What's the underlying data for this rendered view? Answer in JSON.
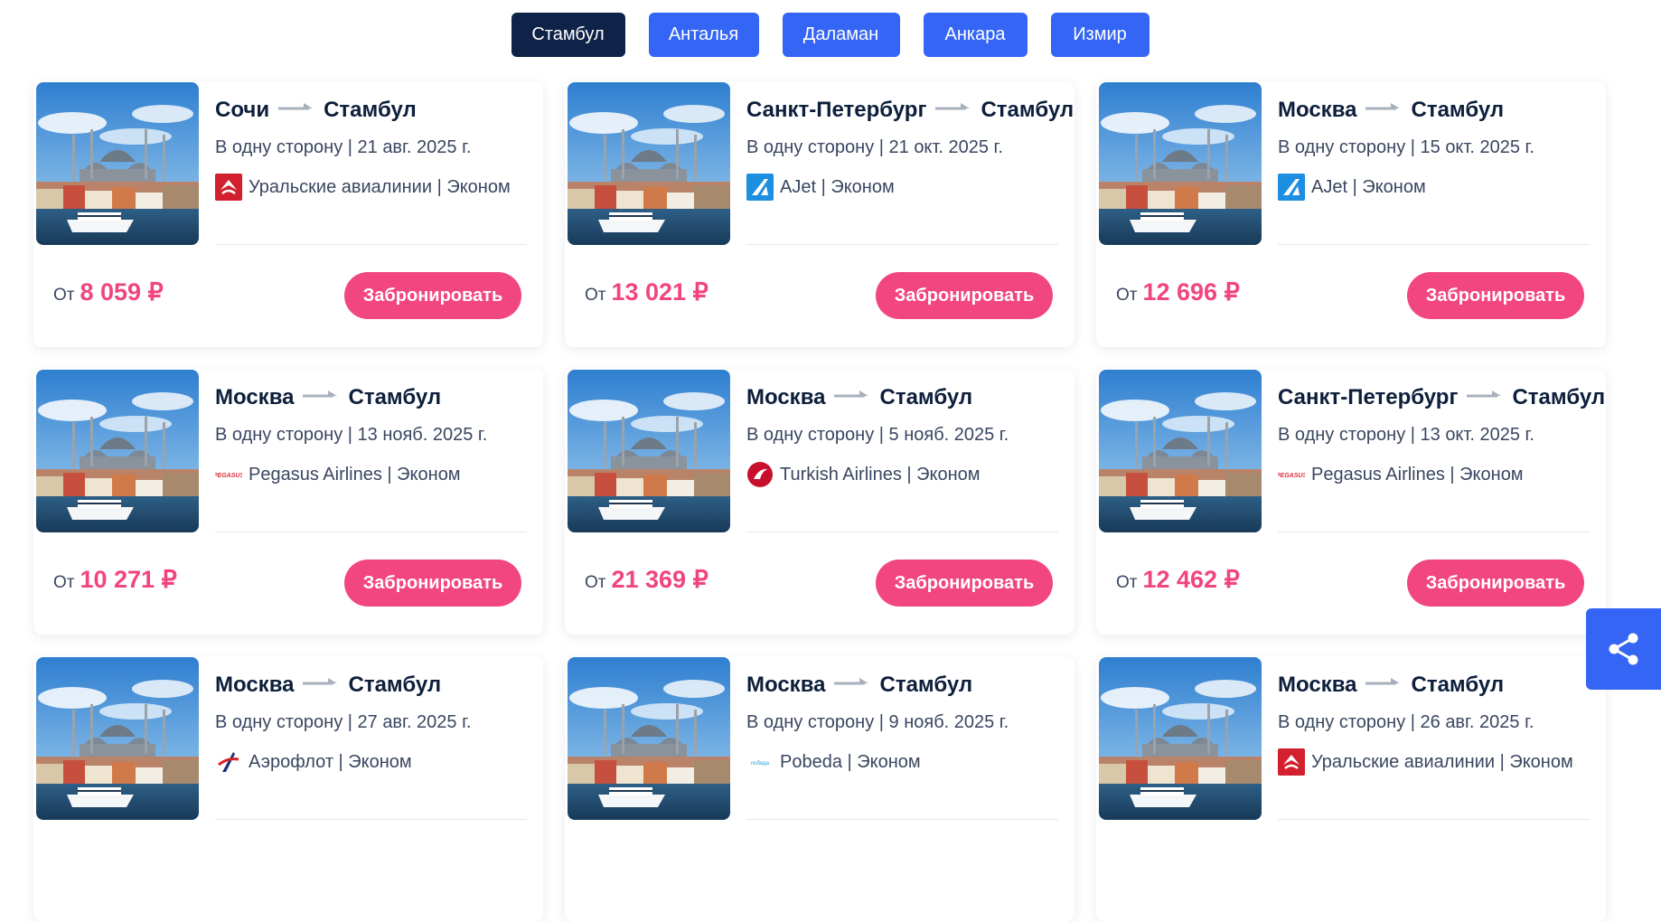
{
  "tabs": [
    "Стамбул",
    "Анталья",
    "Даламан",
    "Анкара",
    "Измир"
  ],
  "active_tab": 0,
  "price_prefix": "От",
  "book_label": "Забронировать",
  "colors": {
    "accent_blue": "#3465f4",
    "active_tab": "#0f2248",
    "pink": "#f24680",
    "navy_text": "#0d1f3c"
  },
  "cards": [
    {
      "from": "Сочи",
      "to": "Стамбул",
      "trip": "В одну сторону | 21 авг. 2025 г.",
      "airline": "Уральские авиалинии | Эконом",
      "logo": "ural-airlines-logo",
      "price": "8 059 ₽"
    },
    {
      "from": "Санкт-Петербург",
      "to": "Стамбул",
      "trip": "В одну сторону | 21 окт. 2025 г.",
      "airline": "AJet | Эконом",
      "logo": "ajet-logo",
      "price": "13 021 ₽"
    },
    {
      "from": "Москва",
      "to": "Стамбул",
      "trip": "В одну сторону | 15 окт. 2025 г.",
      "airline": "AJet | Эконом",
      "logo": "ajet-logo",
      "price": "12 696 ₽"
    },
    {
      "from": "Москва",
      "to": "Стамбул",
      "trip": "В одну сторону | 13 нояб. 2025 г.",
      "airline": "Pegasus Airlines | Эконом",
      "logo": "pegasus-logo",
      "price": "10 271 ₽"
    },
    {
      "from": "Москва",
      "to": "Стамбул",
      "trip": "В одну сторону | 5 нояб. 2025 г.",
      "airline": "Turkish Airlines | Эконом",
      "logo": "turkish-airlines-logo",
      "price": "21 369 ₽"
    },
    {
      "from": "Санкт-Петербург",
      "to": "Стамбул",
      "trip": "В одну сторону | 13 окт. 2025 г.",
      "airline": "Pegasus Airlines | Эконом",
      "logo": "pegasus-logo",
      "price": "12 462 ₽"
    },
    {
      "from": "Москва",
      "to": "Стамбул",
      "trip": "В одну сторону | 27 авг. 2025 г.",
      "airline": "Аэрофлот | Эконом",
      "logo": "aeroflot-logo",
      "price": ""
    },
    {
      "from": "Москва",
      "to": "Стамбул",
      "trip": "В одну сторону | 9 нояб. 2025 г.",
      "airline": "Pobeda | Эконом",
      "logo": "pobeda-logo",
      "price": ""
    },
    {
      "from": "Москва",
      "to": "Стамбул",
      "trip": "В одну сторону | 26 авг. 2025 г.",
      "airline": "Уральские авиалинии | Эконом",
      "logo": "ural-airlines-logo",
      "price": ""
    }
  ],
  "share_icon": "share-icon"
}
